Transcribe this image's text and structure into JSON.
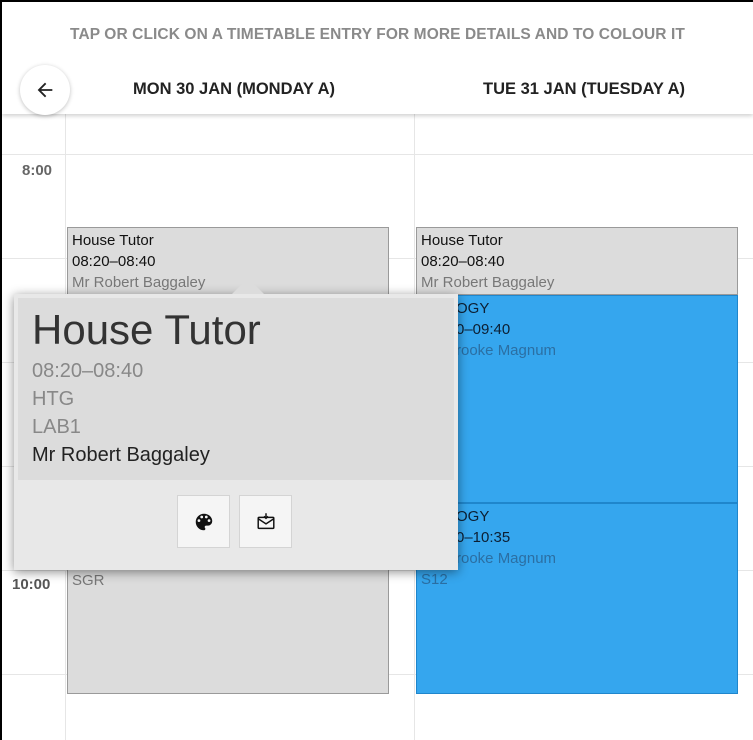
{
  "instructions": "TAP OR CLICK ON A TIMETABLE ENTRY FOR MORE DETAILS AND TO COLOUR IT",
  "back_icon": "arrow-left-icon",
  "days": {
    "mon": "MON 30 JAN (MONDAY A)",
    "tue": "TUE 31 JAN (TUESDAY A)"
  },
  "times": {
    "t8": "8:00",
    "t10": "10:00"
  },
  "entries": {
    "mon_tutor": {
      "title": "House Tutor",
      "time": "08:20–08:40",
      "teacher": "Mr Robert Baggaley"
    },
    "mon_lesson": {
      "room": "SGR"
    },
    "tue_tutor": {
      "title": "House Tutor",
      "time": "08:20–08:40",
      "teacher": "Mr Robert Baggaley"
    },
    "tue_bio1": {
      "title": "OGY",
      "time": "0–09:40",
      "teacher": "rooke Magnum"
    },
    "tue_bio2": {
      "title": "OGY",
      "time": "0–10:35",
      "teacher": "rooke Magnum",
      "room": "S12"
    }
  },
  "popup": {
    "title": "House Tutor",
    "time": "08:20–08:40",
    "code": "HTG",
    "room": "LAB1",
    "teacher": "Mr Robert Baggaley",
    "buttons": {
      "colour_icon": "palette-icon",
      "email_icon": "email-icon"
    }
  },
  "colors": {
    "grey_entry": "#dcdcdc",
    "blue_entry": "#35a6ee"
  }
}
